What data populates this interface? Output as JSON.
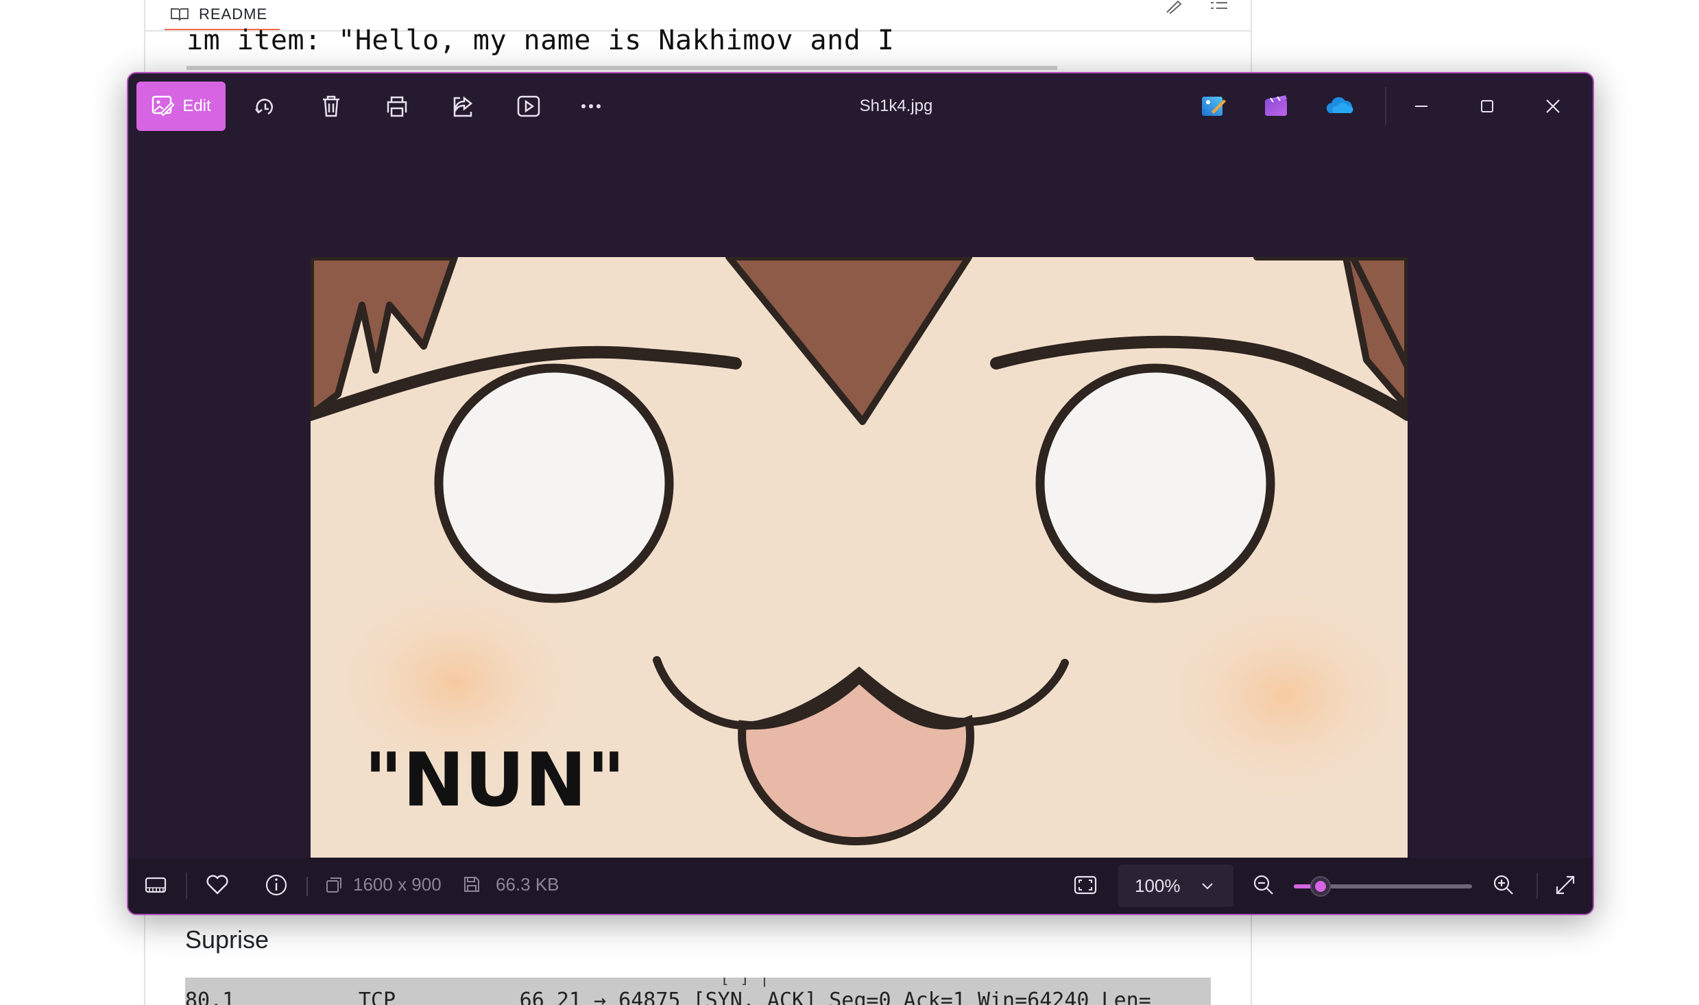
{
  "background": {
    "readme_tab": "README",
    "code_text": "ım item: \"Hello, my name is Nakhimov and I",
    "section_heading": "Suprise",
    "packet_line": "80.1          TCP          66 21 → 64875 [SYN, ACK] Seq=0 Ack=1 Win=64240 Len="
  },
  "window": {
    "filename": "Sh1k4.jpg",
    "toolbar": {
      "edit_label": "Edit",
      "icons": [
        "edit-image-icon",
        "rotate-icon",
        "delete-icon",
        "print-icon",
        "share-icon",
        "slideshow-icon",
        "more-icon"
      ],
      "apps": [
        "photo-editor-icon",
        "clipchamp-icon",
        "onedrive-icon"
      ]
    },
    "window_controls": [
      "minimize-icon",
      "maximize-icon",
      "close-icon"
    ],
    "image": {
      "caption": "\"NUN\""
    },
    "statusbar": {
      "dimensions": "1600 x 900",
      "file_size": "66.3 KB",
      "zoom": "100%",
      "zoom_slider_level": 0.15
    },
    "colors": {
      "accent": "#d664e3",
      "window_bg": "#251a2f",
      "statusbar_bg": "#1f1727"
    }
  }
}
